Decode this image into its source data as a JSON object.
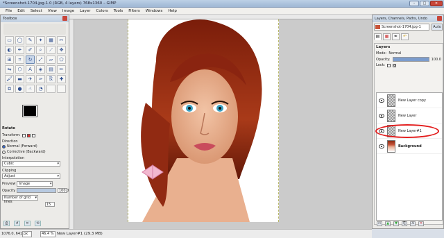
{
  "window": {
    "title": "*Screenshot-1704.jpg-1.0 (RGB, 4 layers) 768x1360 – GIMP",
    "controls": [
      "–",
      "□",
      "✕"
    ]
  },
  "menu": [
    "File",
    "Edit",
    "Select",
    "View",
    "Image",
    "Layer",
    "Colors",
    "Tools",
    "Filters",
    "Windows",
    "Help"
  ],
  "toolbox": {
    "title": "Toolbox",
    "tool_options": {
      "title": "Rotate",
      "transform_label": "Transform:",
      "direction_label": "Direction",
      "direction_normal": "Normal (Forward)",
      "direction_corrective": "Corrective (Backward)",
      "interpolation_label": "Interpolation",
      "interpolation_value": "Cubic",
      "clipping_label": "Clipping",
      "clipping_value": "Adjust",
      "preview_label": "Preview",
      "preview_value": "Image",
      "opacity_label": "Opacity",
      "opacity_value": "100.0",
      "opacity_fraction": 1.0,
      "grid_value": "Number of grid lines",
      "grid_number": "15"
    }
  },
  "status": {
    "coords": "1076.0, 641.0",
    "unit": "px",
    "zoom": "46.4 %",
    "message": "New Layer#1 (29.3 MB)"
  },
  "layers_dock": {
    "title": "Layers, Channels, Paths, Undo",
    "image_name": "Screenshot-1704.jpg-1",
    "auto_label": "Auto",
    "layers_title": "Layers",
    "mode_label": "Mode:",
    "mode_value": "Normal",
    "opacity_label": "Opacity:",
    "opacity_value": "100.0",
    "opacity_fraction": 1.0,
    "lock_label": "Lock:",
    "layers": [
      {
        "name": "New Layer copy",
        "bold": false,
        "thumb": "transparent"
      },
      {
        "name": "New Layer",
        "bold": false,
        "thumb": "transparent"
      },
      {
        "name": "New Layer#1",
        "bold": false,
        "thumb": "transparent",
        "highlighted": true
      },
      {
        "name": "Background",
        "bold": true,
        "thumb": "photo"
      }
    ]
  },
  "colors": {
    "accent": "#e31d1d",
    "titlebar": "#bcd0e6"
  }
}
